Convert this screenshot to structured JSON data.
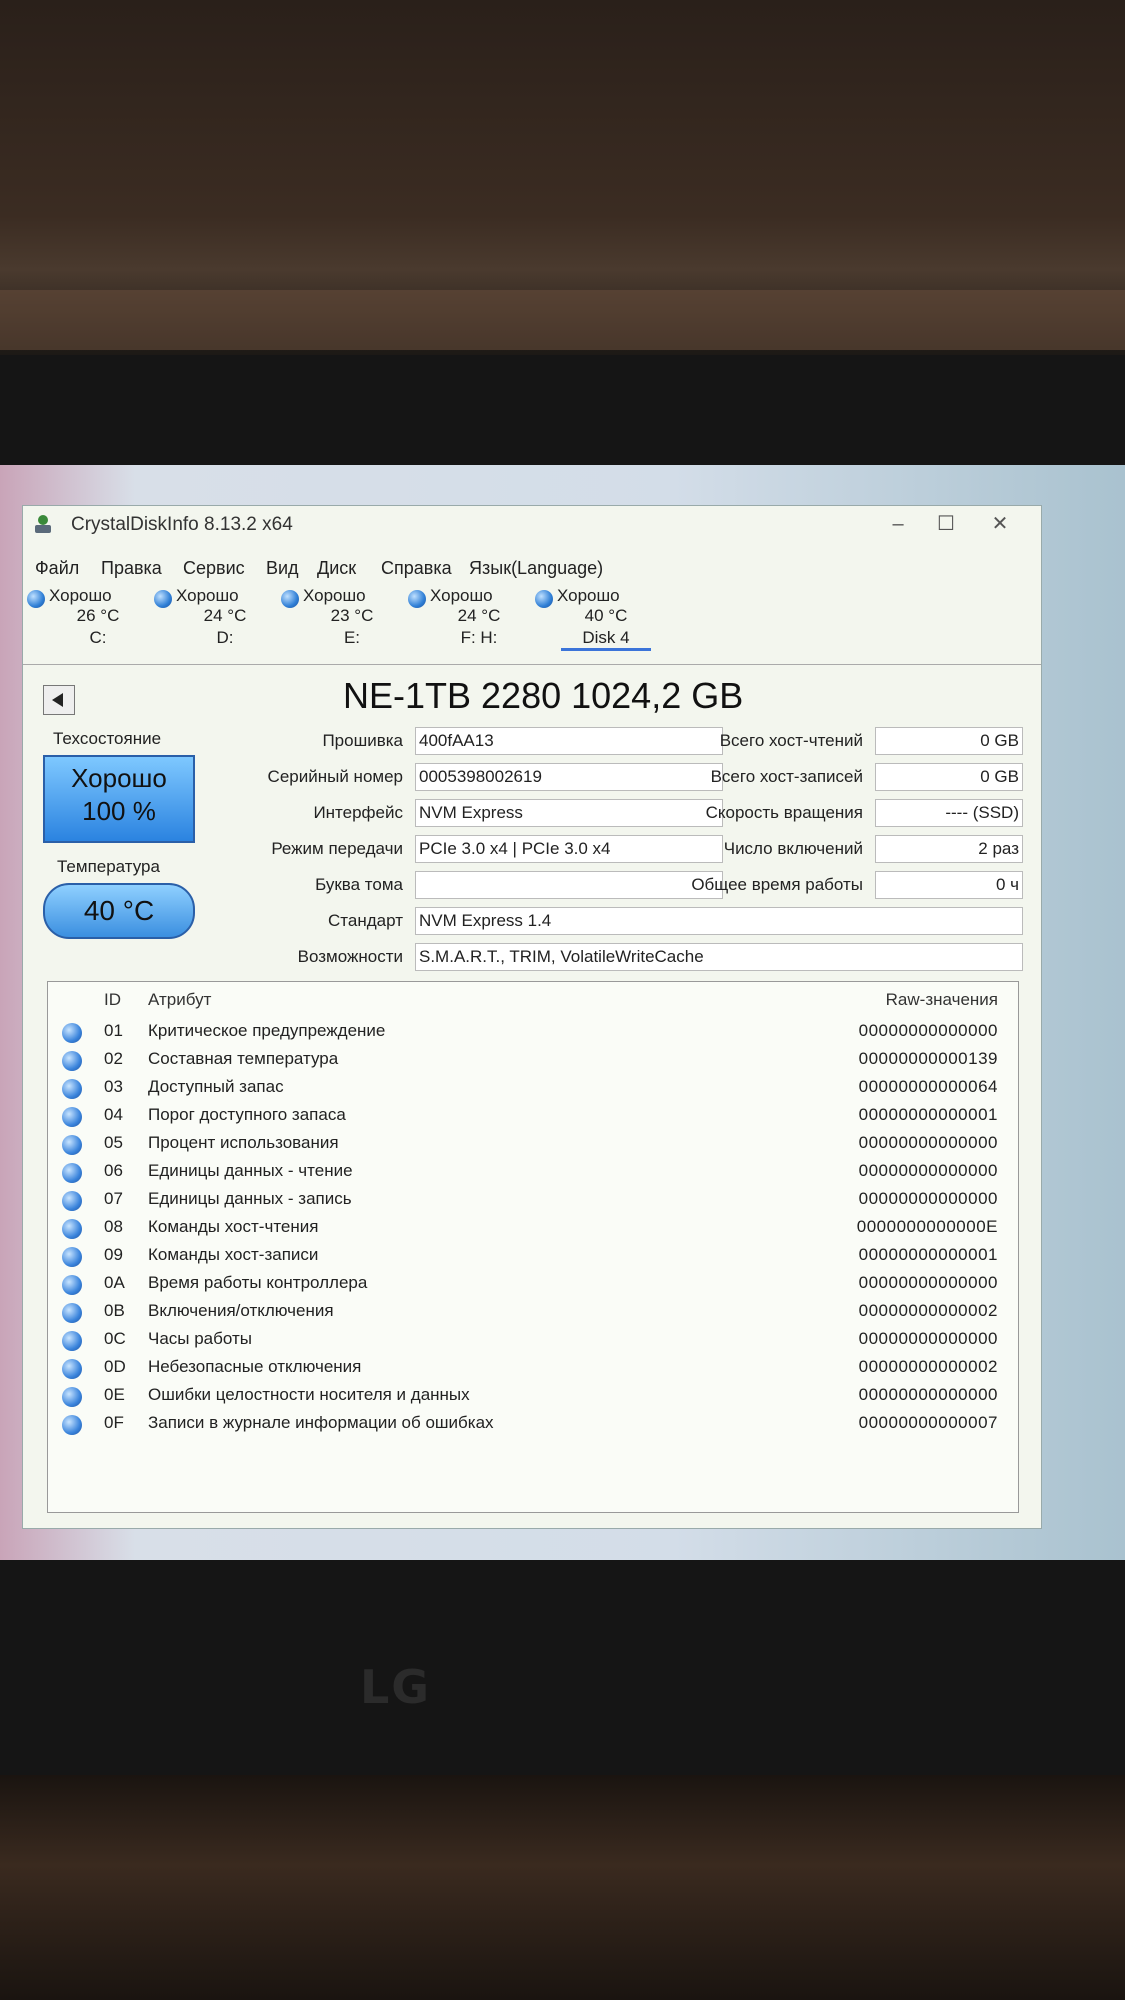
{
  "app": {
    "title": "CrystalDiskInfo 8.13.2 x64"
  },
  "menu": [
    "Файл",
    "Правка",
    "Сервис",
    "Вид",
    "Диск",
    "Справка",
    "Язык(Language)"
  ],
  "drives": [
    {
      "status": "Хорошо",
      "temp": "26 °C",
      "letter": "C:"
    },
    {
      "status": "Хорошо",
      "temp": "24 °C",
      "letter": "D:"
    },
    {
      "status": "Хорошо",
      "temp": "23 °C",
      "letter": "E:"
    },
    {
      "status": "Хорошо",
      "temp": "24 °C",
      "letter": "F: H:"
    },
    {
      "status": "Хорошо",
      "temp": "40 °C",
      "letter": "Disk 4"
    }
  ],
  "disk": {
    "model": "NE-1TB 2280 1024,2 GB"
  },
  "health": {
    "label": "Техсостояние",
    "status": "Хорошо",
    "percent": "100 %"
  },
  "temperature": {
    "label": "Температура",
    "value": "40 °C"
  },
  "info_left": [
    {
      "label": "Прошивка",
      "value": "400fAA13"
    },
    {
      "label": "Серийный номер",
      "value": "0005398002619"
    },
    {
      "label": "Интерфейс",
      "value": "NVM Express"
    },
    {
      "label": "Режим передачи",
      "value": "PCIe 3.0 x4 | PCIe 3.0 x4"
    },
    {
      "label": "Буква тома",
      "value": ""
    }
  ],
  "info_right": [
    {
      "label": "Всего хост-чтений",
      "value": "0 GB"
    },
    {
      "label": "Всего хост-записей",
      "value": "0 GB"
    },
    {
      "label": "Скорость вращения",
      "value": "---- (SSD)"
    },
    {
      "label": "Число включений",
      "value": "2 раз"
    },
    {
      "label": "Общее время работы",
      "value": "0 ч"
    }
  ],
  "standard": {
    "label": "Стандарт",
    "value": "NVM Express 1.4"
  },
  "features": {
    "label": "Возможности",
    "value": "S.M.A.R.T., TRIM, VolatileWriteCache"
  },
  "smart": {
    "headers": {
      "id": "ID",
      "attr": "Атрибут",
      "raw": "Raw-значения"
    },
    "rows": [
      {
        "id": "01",
        "name": "Критическое предупреждение",
        "raw": "00000000000000"
      },
      {
        "id": "02",
        "name": "Составная температура",
        "raw": "00000000000139"
      },
      {
        "id": "03",
        "name": "Доступный запас",
        "raw": "00000000000064"
      },
      {
        "id": "04",
        "name": "Порог доступного запаса",
        "raw": "00000000000001"
      },
      {
        "id": "05",
        "name": "Процент использования",
        "raw": "00000000000000"
      },
      {
        "id": "06",
        "name": "Единицы данных - чтение",
        "raw": "00000000000000"
      },
      {
        "id": "07",
        "name": "Единицы данных - запись",
        "raw": "00000000000000"
      },
      {
        "id": "08",
        "name": "Команды хост-чтения",
        "raw": "0000000000000E"
      },
      {
        "id": "09",
        "name": "Команды хост-записи",
        "raw": "00000000000001"
      },
      {
        "id": "0A",
        "name": "Время работы контроллера",
        "raw": "00000000000000"
      },
      {
        "id": "0B",
        "name": "Включения/отключения",
        "raw": "00000000000002"
      },
      {
        "id": "0C",
        "name": "Часы работы",
        "raw": "00000000000000"
      },
      {
        "id": "0D",
        "name": "Небезопасные отключения",
        "raw": "00000000000002"
      },
      {
        "id": "0E",
        "name": "Ошибки целостности носителя и данных",
        "raw": "00000000000000"
      },
      {
        "id": "0F",
        "name": "Записи в журнале информации об ошибках",
        "raw": "00000000000007"
      }
    ]
  },
  "monitor_brand": "LG",
  "colors": {
    "good": "#2b83e0",
    "accent": "#3b74d9"
  }
}
